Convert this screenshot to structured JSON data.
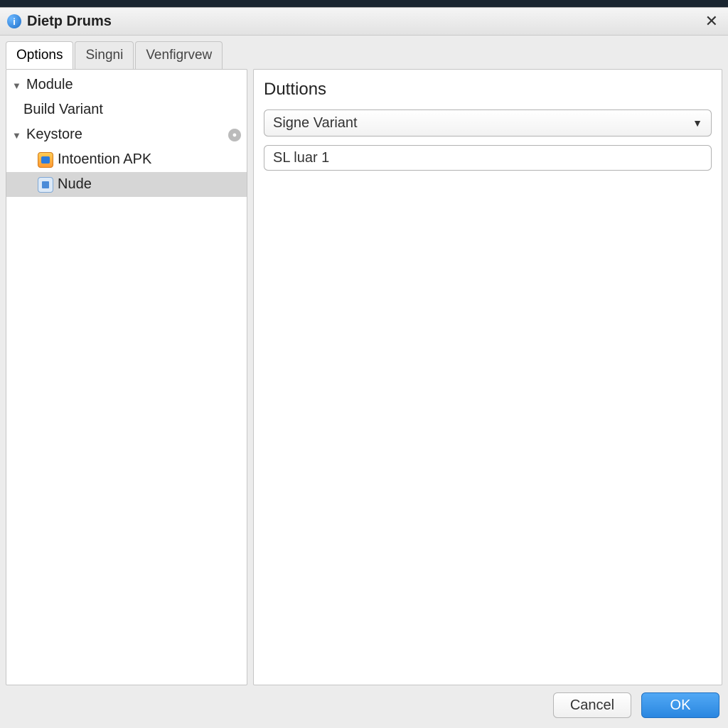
{
  "window": {
    "title": "Dietp Drums"
  },
  "tabs": [
    {
      "label": "Options",
      "active": true
    },
    {
      "label": "Singni",
      "active": false
    },
    {
      "label": "Venfigrvew",
      "active": false
    }
  ],
  "tree": {
    "module_label": "Module",
    "build_variant_label": "Build Variant",
    "keystore_label": "Keystore",
    "items": [
      {
        "icon": "apk-icon",
        "label": "Intoention  APK"
      },
      {
        "icon": "node-icon",
        "label": "Nude",
        "selected": true
      }
    ]
  },
  "content": {
    "heading": "Duttions",
    "combo_value": "Signe Variant",
    "text_value": "SL luar 1"
  },
  "footer": {
    "cancel_label": "Cancel",
    "ok_label": "OK"
  },
  "icons": {
    "app": "info-icon",
    "close": "close-icon",
    "disclosure": "chevron-down-icon",
    "keystore_badge": "dot-icon",
    "dropdown_caret": "triangle-down-icon"
  }
}
